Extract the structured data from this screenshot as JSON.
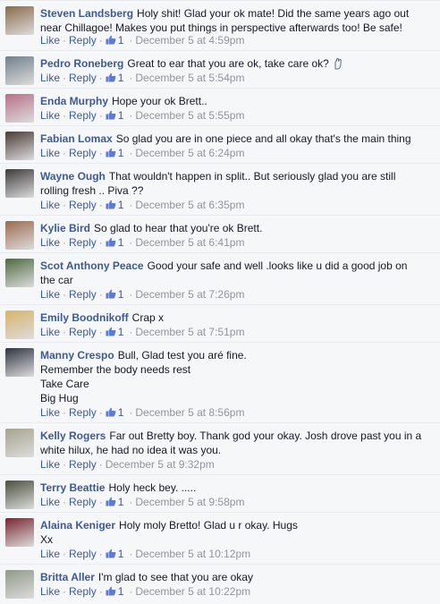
{
  "ui": {
    "like_label": "Like",
    "reply_label": "Reply",
    "sep": "·"
  },
  "colors": {
    "name": "#3b5998",
    "meta": "#90949c",
    "bg": "#f6f7f9"
  },
  "comments": [
    {
      "name": "Steven Landsberg",
      "text": "Holy shit! Glad your ok mate! Did the same years ago out near Chillagoe! Makes you put things in perspective afterwards too! Be safe!",
      "likes": "1",
      "time": "December 5 at 4:59pm",
      "avatar_color": "#8a6b4a",
      "wrap": "Holy shit! Glad your ok mate! Did the same years ago out\nnear Chillagoe! Makes you put things in perspective afterwards too! Be safe!"
    },
    {
      "name": "Pedro Roneberg",
      "text": "Great to ear that you are ok, take care ok?",
      "likes": "1",
      "time": "December 5 at 5:54pm",
      "avatar_color": "#6f7f8c",
      "emoji": "hand-icon"
    },
    {
      "name": "Enda Murphy",
      "text": "Hope your ok Brett..",
      "likes": "1",
      "time": "December 5 at 5:55pm",
      "avatar_color": "#b86f88"
    },
    {
      "name": "Fabian Lomax",
      "text": "So glad you are in one piece and all okay that's the main thing",
      "likes": "1",
      "time": "December 5 at 6:24pm",
      "avatar_color": "#4a3a36"
    },
    {
      "name": "Wayne Ough",
      "text": "That wouldn't happen in split.. But seriously glad you are still rolling fresh .. Piva ??",
      "likes": "1",
      "time": "December 5 at 6:35pm",
      "avatar_color": "#3d3a3a",
      "wrap": "That wouldn't happen in split.. But seriously glad you are still\nrolling fresh .. Piva ??"
    },
    {
      "name": "Kylie Bird",
      "text": "So glad to hear that you're ok Brett.",
      "likes": "1",
      "time": "December 5 at 6:41pm",
      "avatar_color": "#9b6b4f"
    },
    {
      "name": "Scot Anthony Peace",
      "text": "Good your safe and well .looks like u did a good job on the car",
      "likes": "1",
      "time": "December 5 at 7:26pm",
      "avatar_color": "#4f6a3f",
      "wrap": "Good your safe and well .looks like u did a good job on\nthe car"
    },
    {
      "name": "Emily Boodnikoff",
      "text": "Crap x",
      "likes": "1",
      "time": "December 5 at 7:51pm",
      "avatar_color": "#d9b36a"
    },
    {
      "name": "Manny Crespo",
      "text": "Bull, Glad test you aré fine.\nRemember the body needs rest\nTake Care\nBig Hug",
      "likes": "1",
      "time": "December 5 at 8:56pm",
      "avatar_color": "#2e3440"
    },
    {
      "name": "Kelly Rogers",
      "text": "Far out Bretty boy. Thank god your okay. Josh drove past you in a white hilux, he had no idea it was you.",
      "likes": "",
      "time": "December 5 at 9:32pm",
      "avatar_color": "#a7a38e",
      "wrap": "Far out Bretty boy. Thank god your okay. Josh drove past you in a\nwhite hilux, he had no idea it was you."
    },
    {
      "name": "Terry Beattie",
      "text": "Holy heck bey. .....",
      "likes": "1",
      "time": "December 5 at 9:58pm",
      "avatar_color": "#4b4f3e"
    },
    {
      "name": "Alaina Keniger",
      "text": "Holy moly Bretto! Glad u r okay. Hugs\nXx",
      "likes": "1",
      "time": "December 5 at 10:12pm",
      "avatar_color": "#7a2630"
    },
    {
      "name": "Britta Aller",
      "text": "I'm glad to see that you are okay",
      "likes": "1",
      "time": "December 5 at 10:22pm",
      "avatar_color": "#8f9b8a"
    }
  ]
}
